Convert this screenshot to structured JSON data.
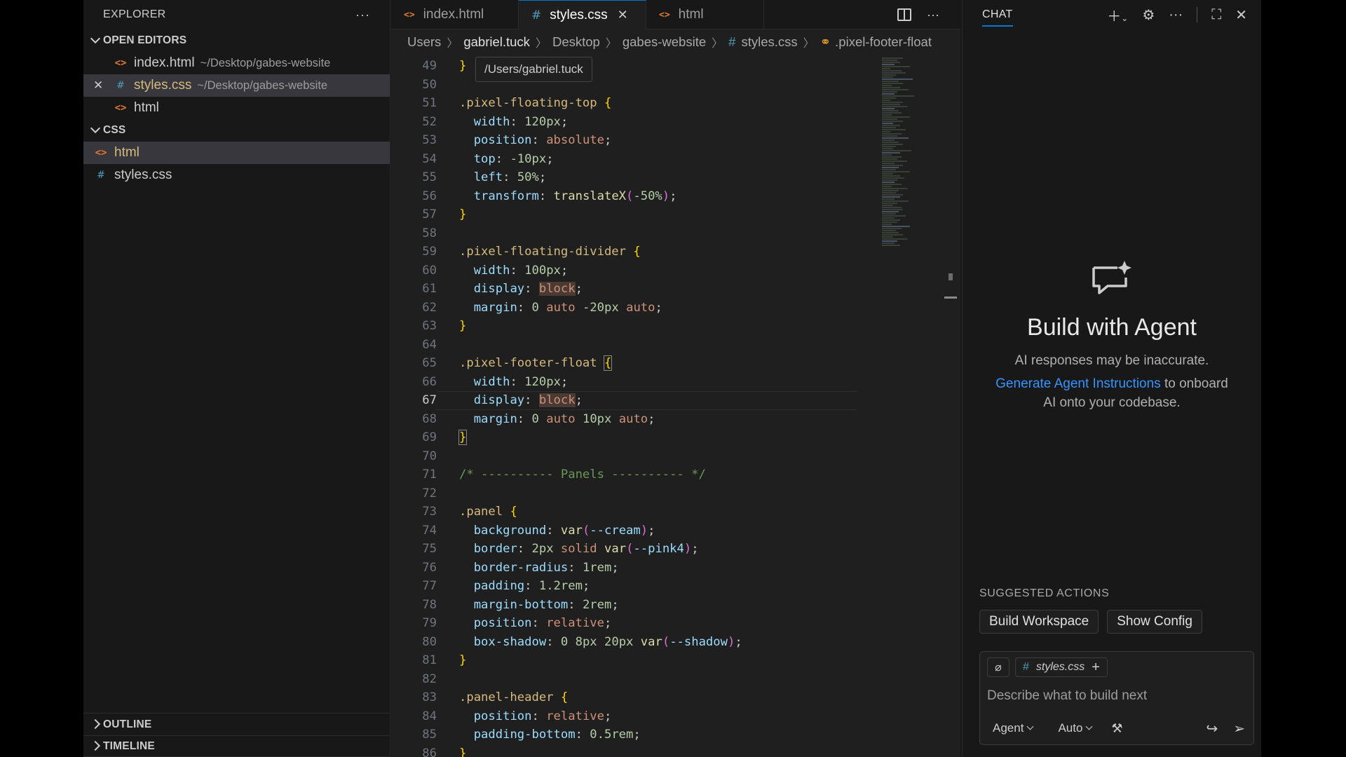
{
  "explorer": {
    "title": "EXPLORER",
    "more": "···",
    "open_editors_label": "OPEN EDITORS",
    "open_editors": [
      {
        "name": "index.html",
        "path": "~/Desktop/gabes-website"
      },
      {
        "name": "styles.css",
        "path": "~/Desktop/gabes-website"
      },
      {
        "name": "html",
        "path": ""
      }
    ],
    "folder_label": "CSS",
    "folder_items": [
      {
        "name": "html"
      },
      {
        "name": "styles.css"
      }
    ],
    "outline_label": "OUTLINE",
    "timeline_label": "TIMELINE"
  },
  "tabs": [
    {
      "label": "index.html",
      "icon": "html-file-icon"
    },
    {
      "label": "styles.css",
      "icon": "css-file-icon"
    },
    {
      "label": "html",
      "icon": "html-file-icon"
    }
  ],
  "breadcrumb": {
    "items": [
      "Users",
      "gabriel.tuck",
      "Desktop",
      "gabes-website",
      "styles.css",
      ".pixel-footer-float"
    ]
  },
  "tooltip": "/Users/gabriel.tuck",
  "editor": {
    "line_numbers": [
      "49",
      "50",
      "51",
      "52",
      "53",
      "54",
      "55",
      "56",
      "57",
      "58",
      "59",
      "60",
      "61",
      "62",
      "63",
      "64",
      "65",
      "66",
      "67",
      "68",
      "69",
      "70",
      "71",
      "72",
      "73",
      "74",
      "75",
      "76",
      "77",
      "78",
      "79",
      "80",
      "81",
      "82",
      "83",
      "84",
      "85",
      "86"
    ],
    "current_line": "67"
  },
  "chat": {
    "title": "CHAT",
    "hero_title": "Build with Agent",
    "hero_subtitle": "AI responses may be inaccurate.",
    "hero_link": "Generate Agent Instructions",
    "hero_link_rest": " to onboard",
    "hero_line3": "AI onto your codebase.",
    "suggested_label": "SUGGESTED ACTIONS",
    "suggested_actions": [
      "Build Workspace",
      "Show Config"
    ],
    "context_file": "styles.css",
    "input_placeholder": "Describe what to build next",
    "mode": "Agent",
    "model": "Auto"
  }
}
